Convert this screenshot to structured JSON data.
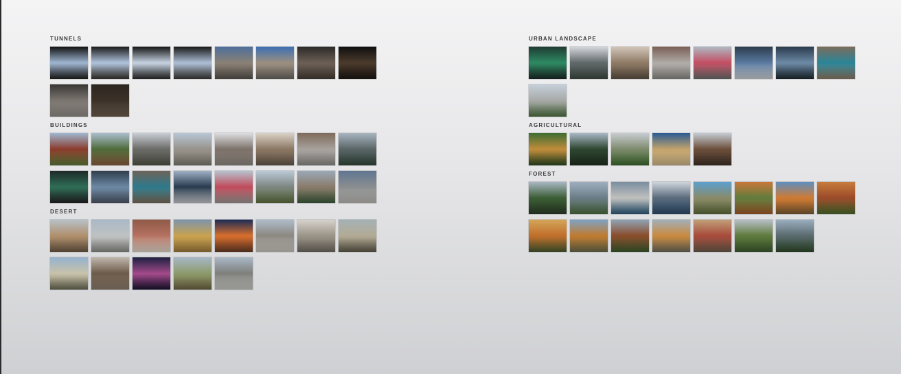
{
  "groups": {
    "tunnels": {
      "title": "TUNNELS",
      "thumbs": [
        {
          "top": "#111",
          "mid": "#9fb6d2",
          "bot": "#202020"
        },
        {
          "top": "#1a1a1a",
          "mid": "#b0c4dd",
          "bot": "#3a3530"
        },
        {
          "top": "#151515",
          "mid": "#c6d3e2",
          "bot": "#2b2b2b"
        },
        {
          "top": "#181818",
          "mid": "#aebfd6",
          "bot": "#3c3a37"
        },
        {
          "top": "#4c6e9b",
          "mid": "#8b8175",
          "bot": "#57524c"
        },
        {
          "top": "#3d6fb3",
          "mid": "#9b8f7f",
          "bot": "#6b6661"
        },
        {
          "top": "#2b2a29",
          "mid": "#6d6055",
          "bot": "#463d36"
        },
        {
          "top": "#0f0f0f",
          "mid": "#4b3b2c",
          "bot": "#1c1712"
        },
        {
          "top": "#393634",
          "mid": "#7b7570",
          "bot": "#8f8a84"
        },
        {
          "top": "#2d2620",
          "mid": "#3b3128",
          "bot": "#6a5b4c"
        }
      ]
    },
    "buildings": {
      "title": "BUILDINGS",
      "thumbs": [
        {
          "top": "#9eb6cf",
          "mid": "#8b3b2c",
          "bot": "#5f7a39"
        },
        {
          "top": "#a9bccd",
          "mid": "#4e6a3a",
          "bot": "#8a5e3e"
        },
        {
          "top": "#c8cdd4",
          "mid": "#6a6a66",
          "bot": "#525549"
        },
        {
          "top": "#b8c6d6",
          "mid": "#97928a",
          "bot": "#7c7a70"
        },
        {
          "top": "#dcdde0",
          "mid": "#7c7169",
          "bot": "#8d877f"
        },
        {
          "top": "#d9d1c6",
          "mid": "#8b7763",
          "bot": "#66584b"
        },
        {
          "top": "#7f6b5c",
          "mid": "#a7a29d",
          "bot": "#8b8986"
        },
        {
          "top": "#a8b5c0",
          "mid": "#596466",
          "bot": "#32483a"
        },
        {
          "top": "#1e2a28",
          "mid": "#2f6e57",
          "bot": "#222"
        },
        {
          "top": "#2f3e4e",
          "mid": "#6d89a4",
          "bot": "#4b5564"
        },
        {
          "top": "#6e6358",
          "mid": "#2d7a8c",
          "bot": "#7a6b5a"
        },
        {
          "top": "#9fb1c6",
          "mid": "#283a4d",
          "bot": "#c0c4c8"
        },
        {
          "top": "#b6c3cf",
          "mid": "#c04a5a",
          "bot": "#9a9692"
        },
        {
          "top": "#b9c9d7",
          "mid": "#7d857f",
          "bot": "#5d6e3d"
        },
        {
          "top": "#9aa9b8",
          "mid": "#8a7b6a",
          "bot": "#3c5a3a"
        },
        {
          "top": "#5f7691",
          "mid": "#8a8d8f",
          "bot": "#b9b7b2"
        }
      ]
    },
    "desert": {
      "title": "DESERT",
      "thumbs": [
        {
          "top": "#b7c1c8",
          "mid": "#b08f6c",
          "bot": "#6e5a45"
        },
        {
          "top": "#a9b8c6",
          "mid": "#bfc2c2",
          "bot": "#8b8b86"
        },
        {
          "top": "#8f5a47",
          "mid": "#b57161",
          "bot": "#e0d4c7"
        },
        {
          "top": "#7d94ab",
          "mid": "#c8a24f",
          "bot": "#9e7b3d"
        },
        {
          "top": "#1a2c57",
          "mid": "#d86e2c",
          "bot": "#6a3c28"
        },
        {
          "top": "#b0bccb",
          "mid": "#8b8880",
          "bot": "#c9c6bf"
        },
        {
          "top": "#d7d3cc",
          "mid": "#9a9388",
          "bot": "#6f6a61"
        },
        {
          "top": "#a4b1b6",
          "mid": "#b3ab94",
          "bot": "#5f5a4a"
        },
        {
          "top": "#95b2cf",
          "mid": "#c9c2a9",
          "bot": "#6a6a55"
        },
        {
          "top": "#bfb7ac",
          "mid": "#6c5a49",
          "bot": "#8a7b6b"
        },
        {
          "top": "#1d2040",
          "mid": "#a34a8b",
          "bot": "#1b1330"
        },
        {
          "top": "#a7b7c7",
          "mid": "#8c9a6a",
          "bot": "#6d6342"
        },
        {
          "top": "#a9b8c6",
          "mid": "#7e7e7b",
          "bot": "#c8c8c4"
        }
      ]
    },
    "urban": {
      "title": "URBAN LANDSCAPE",
      "thumbs": [
        {
          "top": "#1f3b32",
          "mid": "#2d8a63",
          "bot": "#1c2a28"
        },
        {
          "top": "#d5d8dc",
          "mid": "#606869",
          "bot": "#3f4a43"
        },
        {
          "top": "#d2c6b9",
          "mid": "#8e7a65",
          "bot": "#5e5144"
        },
        {
          "top": "#7a5e55",
          "mid": "#b0aca7",
          "bot": "#8b8885"
        },
        {
          "top": "#aeb9c4",
          "mid": "#c34e62",
          "bot": "#6e6e6c"
        },
        {
          "top": "#2c3c4c",
          "mid": "#5a7aa0",
          "bot": "#c8ccd0"
        },
        {
          "top": "#2a3a4c",
          "mid": "#6d8aa6",
          "bot": "#1e2a33"
        },
        {
          "top": "#7b6c5c",
          "mid": "#2a8599",
          "bot": "#8b7a66"
        },
        {
          "top": "#c5d0da",
          "mid": "#a7a9a7",
          "bot": "#4f7043"
        }
      ]
    },
    "agricultural": {
      "title": "AGRICULTURAL",
      "thumbs": [
        {
          "top": "#3d6d33",
          "mid": "#c18c3a",
          "bot": "#2e4a22"
        },
        {
          "top": "#a7b7c4",
          "mid": "#2e4530",
          "bot": "#1f2f21"
        },
        {
          "top": "#c7ccd1",
          "mid": "#7d8a6c",
          "bot": "#3c6a2e"
        },
        {
          "top": "#2c5c94",
          "mid": "#c3a36b",
          "bot": "#cdb489"
        },
        {
          "top": "#c4cbd2",
          "mid": "#6b4e3a",
          "bot": "#3f3127"
        }
      ]
    },
    "forest": {
      "title": "FOREST",
      "thumbs": [
        {
          "top": "#a9b8c4",
          "mid": "#3b5d34",
          "bot": "#2b3d27"
        },
        {
          "top": "#9eb0bf",
          "mid": "#6a7c86",
          "bot": "#4a6c3e"
        },
        {
          "top": "#7a8ea0",
          "mid": "#c0c0bd",
          "bot": "#2d5a7a"
        },
        {
          "top": "#cfd6de",
          "mid": "#5a6a7b",
          "bot": "#2b4b6b"
        },
        {
          "top": "#5aa0d0",
          "mid": "#8a8a68",
          "bot": "#5d6a3a"
        },
        {
          "top": "#c9783a",
          "mid": "#5f7c3d",
          "bot": "#a05a2a"
        },
        {
          "top": "#5d8fc0",
          "mid": "#d07a32",
          "bot": "#7a5a33"
        },
        {
          "top": "#c87c3c",
          "mid": "#9b4a2a",
          "bot": "#4a6a2c"
        },
        {
          "top": "#d3a65a",
          "mid": "#c16e2a",
          "bot": "#4a5a2f"
        },
        {
          "top": "#7ea3c6",
          "mid": "#c07a2f",
          "bot": "#6a6a4a"
        },
        {
          "top": "#90a4b6",
          "mid": "#8a4b2a",
          "bot": "#3c5a2e"
        },
        {
          "top": "#a2b0ba",
          "mid": "#c98a3f",
          "bot": "#6f6a5a"
        },
        {
          "top": "#c1a079",
          "mid": "#a74a3a",
          "bot": "#6a5a4a"
        },
        {
          "top": "#b8c0c8",
          "mid": "#5f7a3c",
          "bot": "#3d5a30"
        },
        {
          "top": "#9aaebf",
          "mid": "#5a6a6e",
          "bot": "#2f4a2a"
        }
      ]
    }
  }
}
